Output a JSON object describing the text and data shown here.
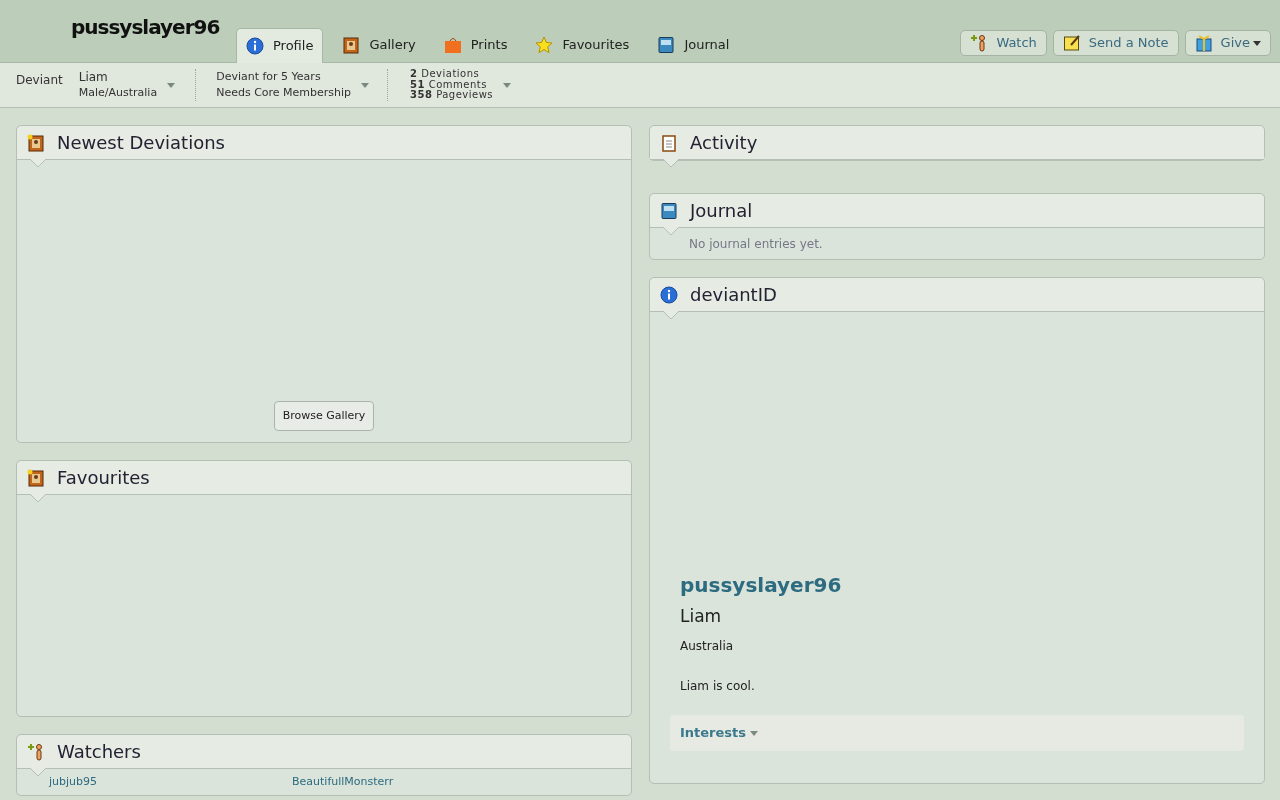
{
  "header": {
    "username": "pussyslayer96",
    "tabs": [
      {
        "label": "Profile",
        "kind": "info",
        "selected": true
      },
      {
        "label": "Gallery",
        "kind": "gallery",
        "selected": false
      },
      {
        "label": "Prints",
        "kind": "prints",
        "selected": false
      },
      {
        "label": "Favourites",
        "kind": "star",
        "selected": false
      },
      {
        "label": "Journal",
        "kind": "journal",
        "selected": false
      }
    ],
    "buttons": [
      {
        "label": "Watch",
        "kind": "watch",
        "dropdown": false
      },
      {
        "label": "Send a Note",
        "kind": "note",
        "dropdown": false
      },
      {
        "label": "Give",
        "kind": "gift",
        "dropdown": true
      }
    ]
  },
  "info_bar": {
    "type": "Deviant",
    "name": "Liam",
    "details": "Male/Australia",
    "tenure": "Deviant for 5 Years",
    "membership": "Needs Core Membership",
    "stats": [
      "**2** Deviations",
      "**51** Comments",
      "**358** Pageviews"
    ]
  },
  "left_column": [
    {
      "title": "Newest Deviations",
      "kind": "gallery",
      "button": "Browse Gallery"
    },
    {
      "title": "Favourites",
      "kind": "favourites"
    },
    {
      "title": "Watchers",
      "kind": "watchers",
      "items": [
        "jubjub95",
        "BeautifullMonsterr"
      ]
    }
  ],
  "right_column": [
    {
      "title": "Activity",
      "kind": "activity"
    },
    {
      "title": "Journal",
      "kind": "journal",
      "text": "No journal entries yet."
    },
    {
      "title": "deviantID",
      "kind": "deviantid",
      "username": "pussyslayer96",
      "name": "Liam",
      "location": "Australia",
      "bio": "Liam is cool.",
      "interests": "Interests"
    }
  ]
}
